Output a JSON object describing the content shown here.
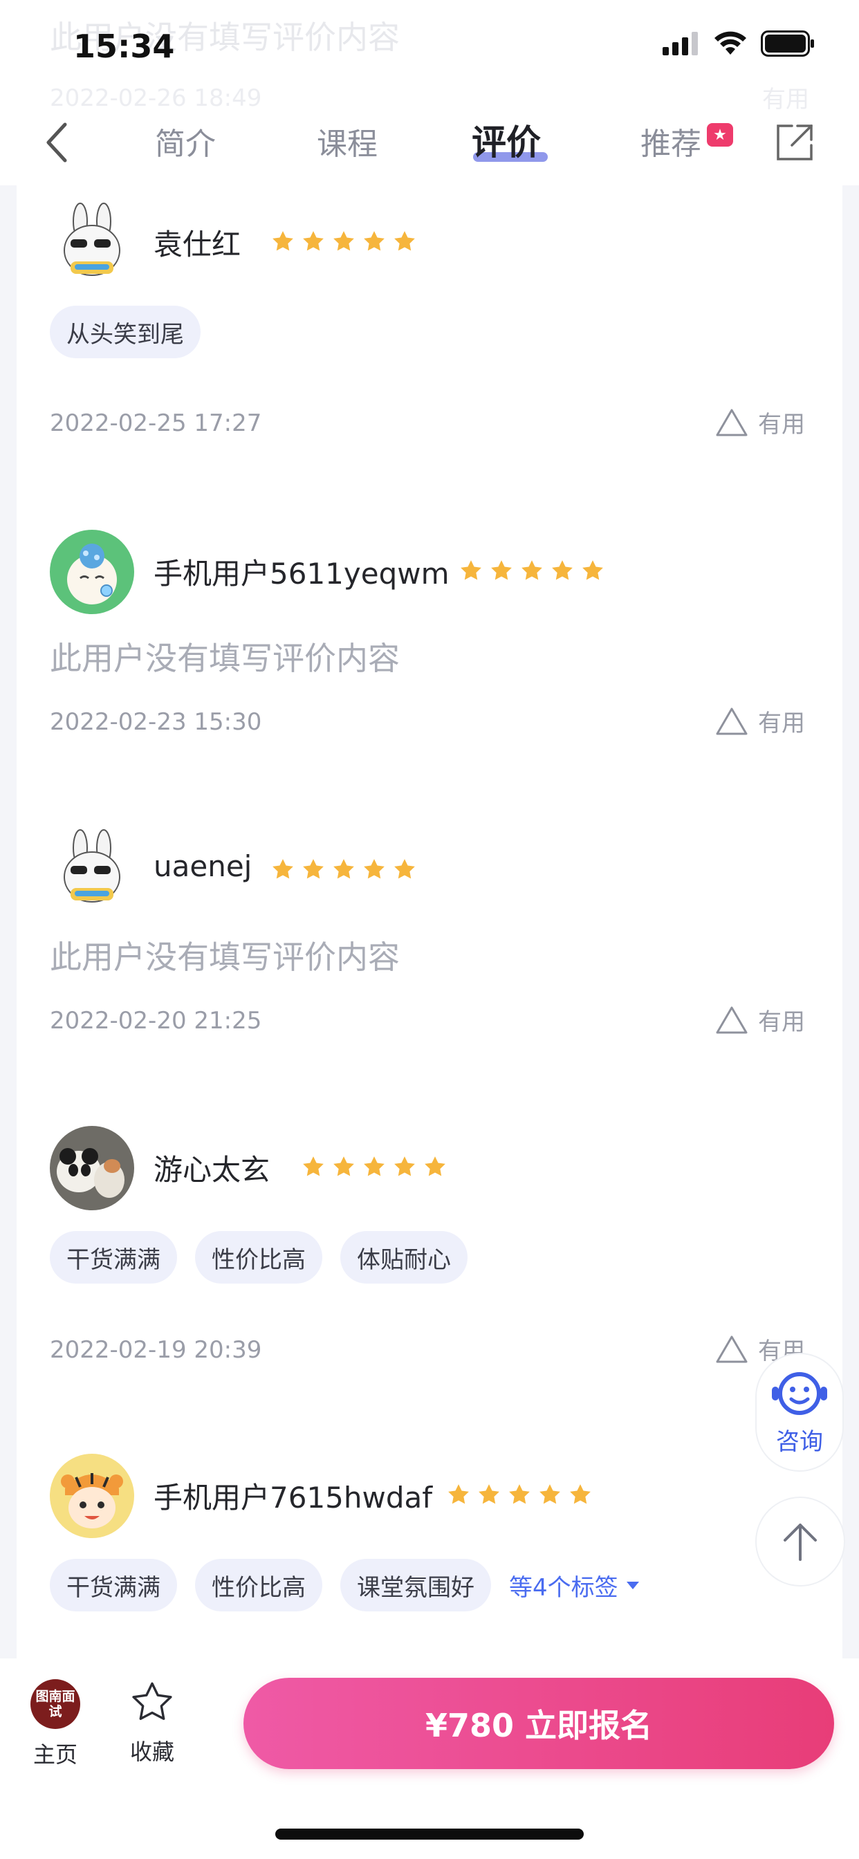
{
  "status_bar": {
    "time": "15:34"
  },
  "ghost": {
    "comment": "此用户没有填写评价内容",
    "date": "2022-02-26 18:49",
    "useful": "有用"
  },
  "nav": {
    "tabs": [
      {
        "label": "简介",
        "active": false
      },
      {
        "label": "课程",
        "active": false
      },
      {
        "label": "评价",
        "active": true
      },
      {
        "label": "推荐",
        "active": false
      }
    ],
    "accent_color": "#7d86e8",
    "badge_color": "#ee3b6c"
  },
  "reviews": [
    {
      "username": "袁仕红",
      "rating": 5,
      "tags": [
        "从头笑到尾"
      ],
      "comment": "",
      "date": "2022-02-25 17:27",
      "useful_label": "有用",
      "avatar": "rabbit-sunglasses"
    },
    {
      "username": "手机用户5611yeqwm",
      "rating": 5,
      "tags": [],
      "comment": "此用户没有填写评价内容",
      "date": "2022-02-23 15:30",
      "useful_label": "有用",
      "avatar": "cat-bubble"
    },
    {
      "username": "uaenej",
      "rating": 5,
      "tags": [],
      "comment": "此用户没有填写评价内容",
      "date": "2022-02-20 21:25",
      "useful_label": "有用",
      "avatar": "rabbit-sunglasses"
    },
    {
      "username": "游心太玄",
      "rating": 5,
      "tags": [
        "干货满满",
        "性价比高",
        "体贴耐心"
      ],
      "comment": "",
      "date": "2022-02-19 20:39",
      "useful_label": "有用",
      "avatar": "panda-cat-photo"
    },
    {
      "username": "手机用户7615hwdaf",
      "rating": 5,
      "tags": [
        "干货满满",
        "性价比高",
        "课堂氛围好"
      ],
      "more_tags": "等4个标签",
      "comment": "",
      "date": "",
      "useful_label": "",
      "avatar": "tiger-kid"
    }
  ],
  "float": {
    "consult_label": "咨询"
  },
  "bottom_bar": {
    "home_label": "主页",
    "home_logo": "图南面试",
    "favorite_label": "收藏",
    "enroll_label": "¥780  立即报名"
  },
  "colors": {
    "star": "#f6b53c",
    "tag_bg": "#eef0fb",
    "link": "#4a6cf0",
    "enroll_start": "#ef5aa6",
    "enroll_end": "#e83d78"
  }
}
